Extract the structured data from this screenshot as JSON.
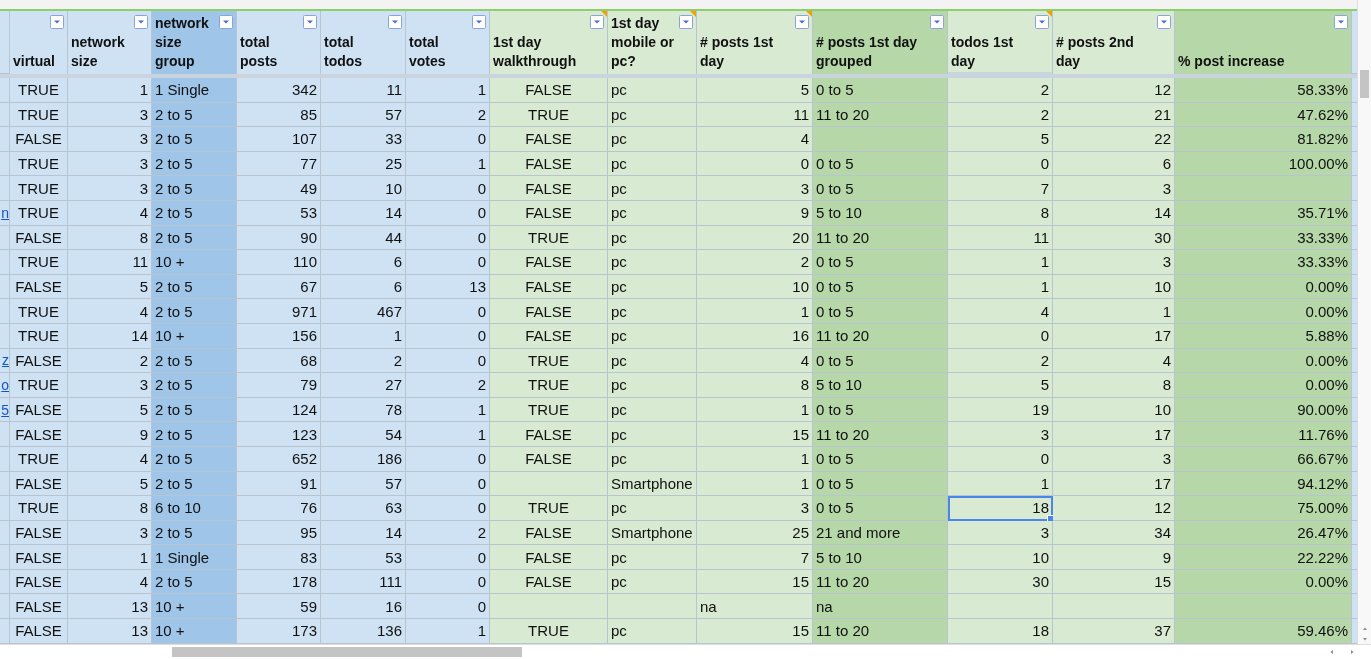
{
  "columns": [
    {
      "label": "virtual",
      "kind": "boolean",
      "color": "#cfe2f3",
      "has_note": false,
      "selected": false
    },
    {
      "label": "network size",
      "kind": "number",
      "color": "#cfe2f3",
      "has_note": false,
      "selected": false
    },
    {
      "label": "network size group",
      "kind": "text",
      "color": "#9fc5e8",
      "has_note": false,
      "selected": false
    },
    {
      "label": "total posts",
      "kind": "number",
      "color": "#cfe2f3",
      "has_note": false,
      "selected": false
    },
    {
      "label": "total todos",
      "kind": "number",
      "color": "#cfe2f3",
      "has_note": false,
      "selected": false
    },
    {
      "label": "total votes",
      "kind": "number",
      "color": "#cfe2f3",
      "has_note": false,
      "selected": false
    },
    {
      "label": "1st day walkthrough",
      "kind": "boolean",
      "color": "#d9ead3",
      "has_note": true,
      "selected": false
    },
    {
      "label": "1st day mobile or pc?",
      "kind": "text",
      "color": "#d9ead3",
      "has_note": true,
      "selected": false
    },
    {
      "label": "# posts 1st day",
      "kind": "number",
      "color": "#d9ead3",
      "has_note": true,
      "selected": false
    },
    {
      "label": "# posts 1st day grouped",
      "kind": "text",
      "color": "#b6d7a8",
      "has_note": false,
      "selected": false
    },
    {
      "label": "todos 1st day",
      "kind": "number",
      "color": "#d9ead3",
      "has_note": true,
      "selected": true
    },
    {
      "label": "# posts 2nd day",
      "kind": "number",
      "color": "#d9ead3",
      "has_note": false,
      "selected": false
    },
    {
      "label": "% post increase",
      "kind": "number",
      "color": "#b6d7a8",
      "has_note": false,
      "selected": false
    }
  ],
  "rows": [
    {
      "selected": false,
      "cells": [
        "TRUE",
        "1",
        "1 Single",
        "342",
        "11",
        "1",
        "FALSE",
        "pc",
        "5",
        "0 to 5",
        "2",
        "12",
        "58.33%"
      ]
    },
    {
      "selected": false,
      "cells": [
        "TRUE",
        "3",
        "2 to 5",
        "85",
        "57",
        "2",
        "TRUE",
        "pc",
        "11",
        "11 to 20",
        "2",
        "21",
        "47.62%"
      ]
    },
    {
      "selected": false,
      "cells": [
        "FALSE",
        "3",
        "2 to 5",
        "107",
        "33",
        "0",
        "FALSE",
        "pc",
        "4",
        null,
        "5",
        "22",
        "81.82%"
      ]
    },
    {
      "selected": false,
      "cells": [
        "TRUE",
        "3",
        "2 to 5",
        "77",
        "25",
        "1",
        "FALSE",
        "pc",
        "0",
        "0 to 5",
        "0",
        "6",
        "100.00%"
      ]
    },
    {
      "selected": false,
      "cells": [
        "TRUE",
        "3",
        "2 to 5",
        "49",
        "10",
        "0",
        "FALSE",
        "pc",
        "3",
        "0 to 5",
        "7",
        "3",
        null
      ]
    },
    {
      "selected": false,
      "link_fragment": "n",
      "cells": [
        "TRUE",
        "4",
        "2 to 5",
        "53",
        "14",
        "0",
        "FALSE",
        "pc",
        "9",
        "5 to 10",
        "8",
        "14",
        "35.71%"
      ]
    },
    {
      "selected": false,
      "cells": [
        "FALSE",
        "8",
        "2 to 5",
        "90",
        "44",
        "0",
        "TRUE",
        "pc",
        "20",
        "11 to 20",
        "11",
        "30",
        "33.33%"
      ]
    },
    {
      "selected": false,
      "cells": [
        "TRUE",
        "11",
        "10 +",
        "110",
        "6",
        "0",
        "FALSE",
        "pc",
        "2",
        "0 to 5",
        "1",
        "3",
        "33.33%"
      ]
    },
    {
      "selected": false,
      "cells": [
        "FALSE",
        "5",
        "2 to 5",
        "67",
        "6",
        "13",
        "FALSE",
        "pc",
        "10",
        "0 to 5",
        "1",
        "10",
        "0.00%"
      ]
    },
    {
      "selected": false,
      "cells": [
        "TRUE",
        "4",
        "2 to 5",
        "971",
        "467",
        "0",
        "FALSE",
        "pc",
        "1",
        "0 to 5",
        "4",
        "1",
        "0.00%"
      ]
    },
    {
      "selected": false,
      "cells": [
        "TRUE",
        "14",
        "10 +",
        "156",
        "1",
        "0",
        "FALSE",
        "pc",
        "16",
        "11 to 20",
        "0",
        "17",
        "5.88%"
      ]
    },
    {
      "selected": false,
      "link_fragment": "z",
      "cells": [
        "FALSE",
        "2",
        "2 to 5",
        "68",
        "2",
        "0",
        "TRUE",
        "pc",
        "4",
        "0 to 5",
        "2",
        "4",
        "0.00%"
      ]
    },
    {
      "selected": false,
      "link_fragment": "o",
      "cells": [
        "TRUE",
        "3",
        "2 to 5",
        "79",
        "27",
        "2",
        "TRUE",
        "pc",
        "8",
        "5 to 10",
        "5",
        "8",
        "0.00%"
      ]
    },
    {
      "selected": false,
      "link_fragment": "5",
      "cells": [
        "FALSE",
        "5",
        "2 to 5",
        "124",
        "78",
        "1",
        "TRUE",
        "pc",
        "1",
        "0 to 5",
        "19",
        "10",
        "90.00%"
      ]
    },
    {
      "selected": false,
      "cells": [
        "FALSE",
        "9",
        "2 to 5",
        "123",
        "54",
        "1",
        "FALSE",
        "pc",
        "15",
        "11 to 20",
        "3",
        "17",
        "11.76%"
      ]
    },
    {
      "selected": false,
      "cells": [
        "TRUE",
        "4",
        "2 to 5",
        "652",
        "186",
        "0",
        "FALSE",
        "pc",
        "1",
        "0 to 5",
        "0",
        "3",
        "66.67%"
      ]
    },
    {
      "selected": false,
      "cells": [
        "FALSE",
        "5",
        "2 to 5",
        "91",
        "57",
        "0",
        null,
        "Smartphone",
        "1",
        "0 to 5",
        "1",
        "17",
        "94.12%"
      ]
    },
    {
      "selected": true,
      "cells": [
        "TRUE",
        "8",
        "6 to 10",
        "76",
        "63",
        "0",
        "TRUE",
        "pc",
        "3",
        "0 to 5",
        "18",
        "12",
        "75.00%"
      ]
    },
    {
      "selected": false,
      "cells": [
        "FALSE",
        "3",
        "2 to 5",
        "95",
        "14",
        "2",
        "FALSE",
        "Smartphone",
        "25",
        "21 and more",
        "3",
        "34",
        "26.47%"
      ]
    },
    {
      "selected": false,
      "cells": [
        "FALSE",
        "1",
        "1 Single",
        "83",
        "53",
        "0",
        "FALSE",
        "pc",
        "7",
        "5 to 10",
        "10",
        "9",
        "22.22%"
      ]
    },
    {
      "selected": false,
      "cells": [
        "FALSE",
        "4",
        "2 to 5",
        "178",
        "111",
        "0",
        "FALSE",
        "pc",
        "15",
        "11 to 20",
        "30",
        "15",
        "0.00%"
      ]
    },
    {
      "selected": false,
      "cells": [
        "FALSE",
        "13",
        "10 +",
        "59",
        "16",
        "0",
        null,
        null,
        "na",
        "na",
        null,
        null,
        null
      ]
    },
    {
      "selected": false,
      "cells": [
        "FALSE",
        "13",
        "10 +",
        "173",
        "136",
        "1",
        "TRUE",
        "pc",
        "15",
        "11 to 20",
        "18",
        "37",
        "59.46%"
      ]
    }
  ]
}
